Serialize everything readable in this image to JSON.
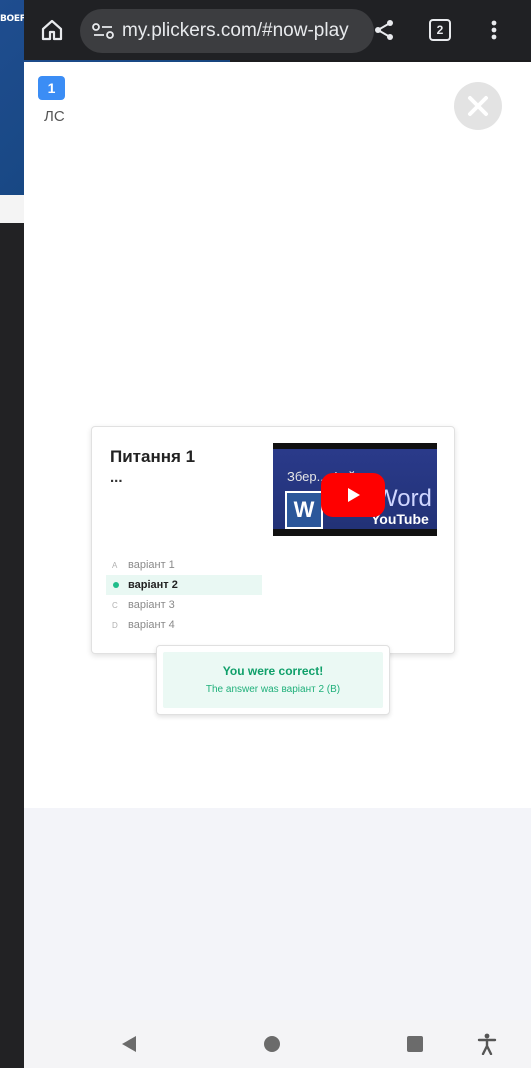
{
  "background": {
    "left_text": "BOEF"
  },
  "browser": {
    "url": "my.plickers.com/#now-play",
    "tab_count": "2"
  },
  "page": {
    "badge_number": "1",
    "class_name": "ЛС",
    "question": {
      "title": "Питання 1",
      "body": "...",
      "video_title": "Збер... Фай...",
      "video_word": "Word",
      "video_brand": "YouTube",
      "choices": [
        {
          "letter": "A",
          "label": "варіант 1",
          "correct": false
        },
        {
          "letter": "B",
          "label": "варіант 2",
          "correct": true
        },
        {
          "letter": "C",
          "label": "варіант 3",
          "correct": false
        },
        {
          "letter": "D",
          "label": "варіант 4",
          "correct": false
        }
      ]
    },
    "result": {
      "heading": "You were correct!",
      "detail": "The answer was варіант 2 (B)"
    }
  },
  "colors": {
    "accent_blue": "#3b8df5",
    "correct_green": "#1fbd8a",
    "youtube_red": "#ff0000"
  }
}
